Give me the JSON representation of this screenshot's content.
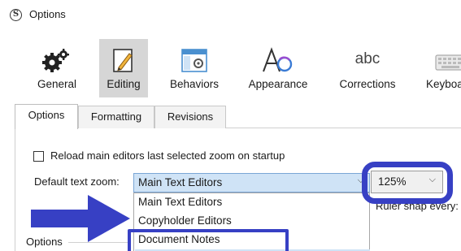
{
  "window": {
    "title": "Options",
    "app_icon": "scrivener-logo-icon"
  },
  "toolbar": {
    "items": [
      {
        "label": "General",
        "icon": "gears-icon"
      },
      {
        "label": "Editing",
        "icon": "pencil-page-icon"
      },
      {
        "label": "Behaviors",
        "icon": "window-gear-icon"
      },
      {
        "label": "Appearance",
        "icon": "font-circle-icon"
      },
      {
        "label": "Corrections",
        "icon": "abc-icon"
      },
      {
        "label": "Keyboa",
        "icon": "keyboard-icon"
      }
    ],
    "selected": "Editing",
    "abc_glyph": "abc"
  },
  "tabs": [
    {
      "label": "Options"
    },
    {
      "label": "Formatting"
    },
    {
      "label": "Revisions"
    }
  ],
  "active_tab": "Options",
  "settings": {
    "reload_zoom": {
      "label": "Reload main editors last selected zoom on startup",
      "checked": false
    },
    "default_zoom": {
      "label": "Default text zoom:",
      "selected": "Main Text Editors",
      "options": [
        "Main Text Editors",
        "Copyholder Editors",
        "Document Notes"
      ]
    },
    "zoom_level": {
      "value": "125%"
    },
    "ruler_snap": {
      "label": "Ruler snap every:"
    },
    "group_label": "Options"
  },
  "glyphs": {
    "chevron": "⌵"
  },
  "colors": {
    "annotation": "#3740c4",
    "selection": "#cfe3f6",
    "toolbar_selected": "#d6d6d6"
  }
}
